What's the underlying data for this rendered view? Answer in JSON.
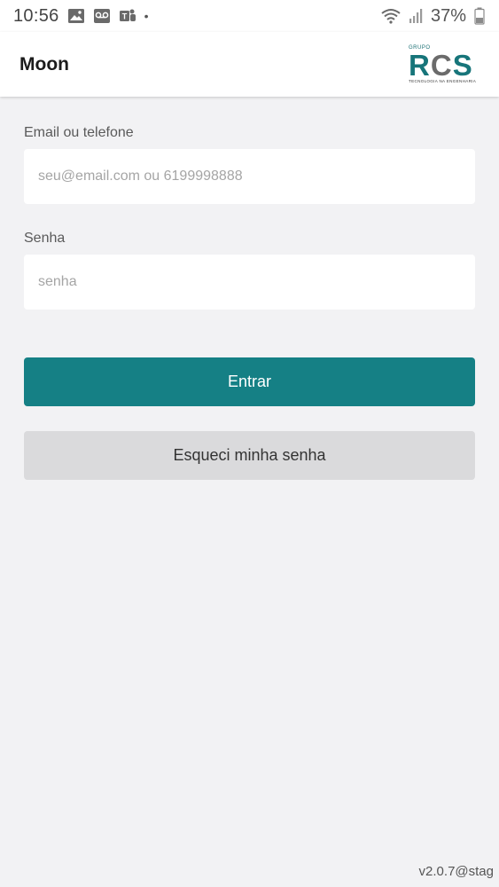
{
  "status_bar": {
    "time": "10:56",
    "battery_percent": "37%",
    "dot": "•",
    "left_icons": [
      "image-icon",
      "voicemail-icon",
      "teams-icon"
    ],
    "right_icons": [
      "wifi-icon",
      "signal-icon",
      "battery-icon"
    ]
  },
  "app_bar": {
    "title": "Moon",
    "logo": {
      "small": "GRUPO",
      "main_r": "R",
      "main_c": "C",
      "main_s": "S",
      "sub": "TECNOLOGIA NA ENGENHARIA"
    }
  },
  "form": {
    "email_label": "Email ou telefone",
    "email_placeholder": "seu@email.com ou 6199998888",
    "email_value": "",
    "password_label": "Senha",
    "password_placeholder": "senha",
    "password_value": "",
    "login_button": "Entrar",
    "forgot_button": "Esqueci minha senha"
  },
  "version": "v2.0.7@stag",
  "colors": {
    "primary": "#158085",
    "secondary_button": "#dadadc",
    "background": "#f2f2f4"
  }
}
